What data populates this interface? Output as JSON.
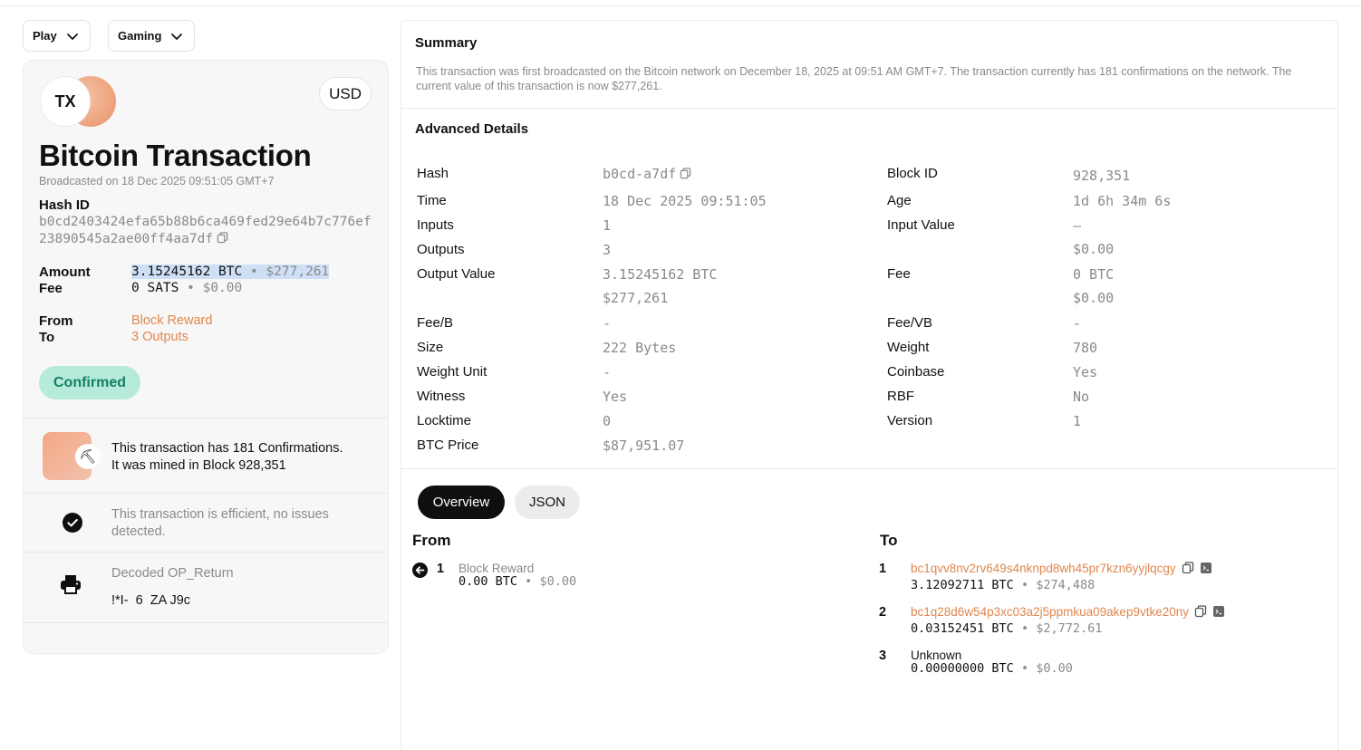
{
  "filters": {
    "play_label": "Play",
    "gaming_label": "Gaming"
  },
  "card": {
    "logo_text": "TX",
    "currency": "USD",
    "title": "Bitcoin Transaction",
    "broadcast": "Broadcasted on 18 Dec 2025 09:51:05 GMT+7",
    "hash_label": "Hash ID",
    "hash_value": "b0cd2403424efa65b88b6ca469fed29e64b7c776ef23890545a2ae00ff4aa7df",
    "amount_label": "Amount",
    "amount_btc": "3.15245162 BTC",
    "amount_usd": "$277,261",
    "fee_label": "Fee",
    "fee_sats": "0 SATS",
    "fee_usd": "$0.00",
    "from_label": "From",
    "from_value": "Block Reward",
    "to_label": "To",
    "to_value": "3 Outputs",
    "status": "Confirmed",
    "confirmations_line1": "This transaction has 181 Confirmations.",
    "confirmations_line2": "It was mined in Block 928,351",
    "efficiency": "This transaction is efficient, no issues detected.",
    "op_return_label": "Decoded OP_Return",
    "op_return_value": "!*I-  6  ZA J9c",
    "separator": "•"
  },
  "summary": {
    "title": "Summary",
    "text": "This transaction was first broadcasted on the Bitcoin network on December 18, 2025 at 09:51 AM GMT+7. The transaction currently has 181 confirmations on the network. The current value of this transaction is now $277,261."
  },
  "advanced": {
    "title": "Advanced Details",
    "left": [
      {
        "label": "Hash",
        "value": "b0cd-a7df"
      },
      {
        "label": "Time",
        "value": "18 Dec 2025 09:51:05"
      },
      {
        "label": "Inputs",
        "value": "1"
      },
      {
        "label": "Outputs",
        "value": "3"
      },
      {
        "label": "Output Value",
        "value": "3.15245162 BTC",
        "value2": "$277,261"
      },
      {
        "label": "Fee/B",
        "value": "-"
      },
      {
        "label": "Size",
        "value": "222 Bytes"
      },
      {
        "label": "Weight Unit",
        "value": "-"
      },
      {
        "label": "Witness",
        "value": "Yes"
      },
      {
        "label": "Locktime",
        "value": "0"
      },
      {
        "label": "BTC Price",
        "value": "$87,951.07"
      }
    ],
    "right": [
      {
        "label": "Block ID",
        "value": "928,351"
      },
      {
        "label": "Age",
        "value": "1d 6h 34m 6s"
      },
      {
        "label": "Input Value",
        "value": "—",
        "value2": "$0.00"
      },
      {
        "label": "Fee",
        "value": "0 BTC",
        "value2": "$0.00"
      },
      {
        "label": "Fee/VB",
        "value": "-"
      },
      {
        "label": "Weight",
        "value": "780"
      },
      {
        "label": "Coinbase",
        "value": "Yes"
      },
      {
        "label": "RBF",
        "value": "No"
      },
      {
        "label": "Version",
        "value": "1"
      }
    ]
  },
  "tabs": {
    "overview": "Overview",
    "json": "JSON"
  },
  "io": {
    "from_title": "From",
    "to_title": "To",
    "inputs": [
      {
        "num": "1",
        "label": "Block Reward",
        "btc": "0.00 BTC",
        "usd": "$0.00"
      }
    ],
    "outputs": [
      {
        "num": "1",
        "address": "bc1qvv8nv2rv649s4nknpd8wh45pr7kzn6yyjlqcgy",
        "btc": "3.12092711 BTC",
        "usd": "$274,488"
      },
      {
        "num": "2",
        "address": "bc1q28d6w54p3xc03a2j5ppmkua09akep9vtke20ny",
        "btc": "0.03152451 BTC",
        "usd": "$2,772.61"
      },
      {
        "num": "3",
        "address": "Unknown",
        "btc": "0.00000000 BTC",
        "usd": "$0.00"
      }
    ]
  },
  "colors": {
    "accent": "#e0874e",
    "confirmed_bg": "#b6eadb",
    "confirmed_text": "#14805f",
    "highlight": "#cfe0f6"
  }
}
